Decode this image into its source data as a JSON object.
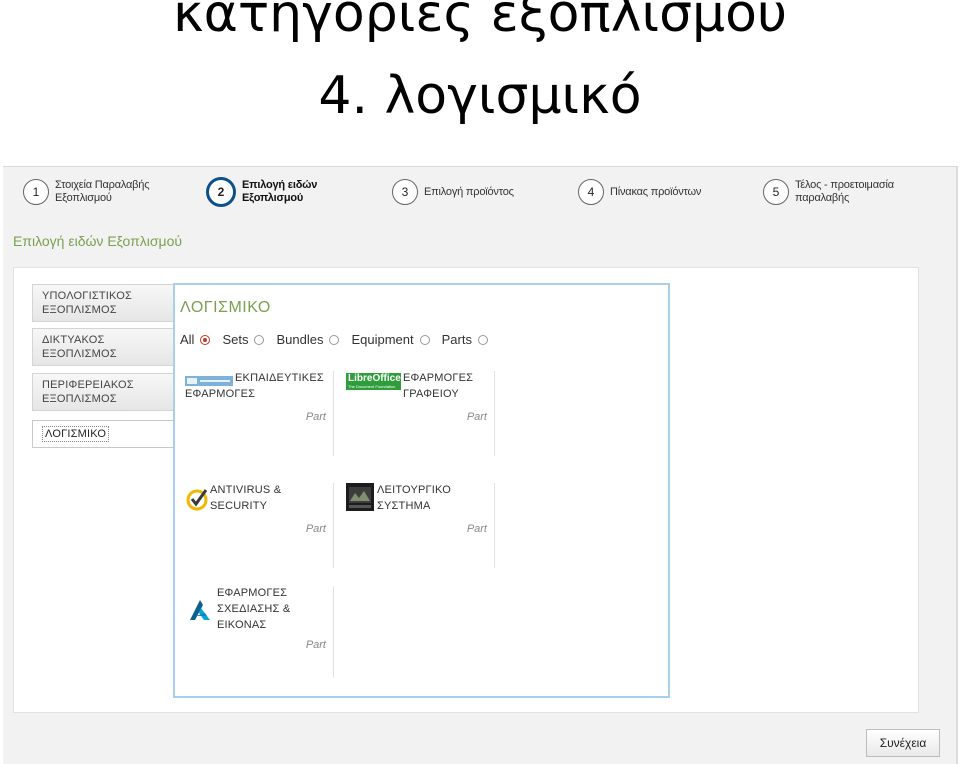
{
  "slide": {
    "title_line1": "κατηγορίες εξοπλισμού",
    "title_line2": "4. λογισμικό"
  },
  "wizard": {
    "steps": [
      {
        "number": "1",
        "label_l1": "Στοιχεία Παραλαβής",
        "label_l2": "Εξοπλισμού"
      },
      {
        "number": "2",
        "label_l1": "Επιλογή ειδών",
        "label_l2": "Εξοπλισμού"
      },
      {
        "number": "3",
        "label_l1": "Επιλογή προϊόντος",
        "label_l2": ""
      },
      {
        "number": "4",
        "label_l1": "Πίνακας προϊόντων",
        "label_l2": ""
      },
      {
        "number": "5",
        "label_l1": "Τέλος - προετοιμασία",
        "label_l2": "παραλαβής"
      }
    ],
    "active_step": 2
  },
  "section_title": "Επιλογή ειδών Εξοπλισμού",
  "categories": [
    {
      "l1": "ΥΠΟΛΟΓΙΣΤΙΚΟΣ",
      "l2": "ΕΞΟΠΛΙΣΜΟΣ"
    },
    {
      "l1": "ΔΙΚΤΥΑΚΟΣ",
      "l2": "ΕΞΟΠΛΙΣΜΟΣ"
    },
    {
      "l1": "ΠΕΡΙΦΕΡΕΙΑΚΟΣ",
      "l2": "ΕΞΟΠΛΙΣΜΟΣ"
    },
    {
      "l1": "ΛΟΓΙΣΜΙΚΟ",
      "l2": ""
    }
  ],
  "content": {
    "title": "ΛΟΓΙΣΜΙΚΟ",
    "filters": [
      {
        "label": "All",
        "checked": true
      },
      {
        "label": "Sets",
        "checked": false
      },
      {
        "label": "Bundles",
        "checked": false
      },
      {
        "label": "Equipment",
        "checked": false
      },
      {
        "label": "Parts",
        "checked": false
      }
    ],
    "products": [
      {
        "l1": "ΕΚΠΑΙΔΕΥΤΙΚΕΣ",
        "l2": "ΕΦΑΡΜΟΓΕΣ",
        "l3": "",
        "tag": "Part",
        "icon": "educational-software-logo"
      },
      {
        "l1": "ΕΦΑΡΜΟΓΕΣ",
        "l2": "ΓΡΑΦΕΙΟΥ",
        "l3": "",
        "tag": "Part",
        "icon": "libreoffice-logo",
        "logo_text": "LibreOffice",
        "logo_sub": "The Document Foundation"
      },
      {
        "l1": "ANTIVIRUS &",
        "l2": "SECURITY",
        "l3": "",
        "tag": "Part",
        "icon": "antivirus-check-icon"
      },
      {
        "l1": "ΛΕΙΤΟΥΡΓΙΚΟ",
        "l2": "ΣΥΣΤΗΜΑ",
        "l3": "",
        "tag": "Part",
        "icon": "operating-system-icon"
      },
      {
        "l1": "ΕΦΑΡΜΟΓΕΣ",
        "l2": "ΣΧΕΔΙΑΣΗΣ &",
        "l3": "ΕΙΚΟΝΑΣ",
        "tag": "Part",
        "icon": "design-software-logo"
      }
    ]
  },
  "continue_button": "Συνέχεια",
  "colors": {
    "accent_green": "#7aa050",
    "active_step": "#0d4f8b",
    "content_border": "#a9cfea",
    "radio_checked": "#c0392b"
  }
}
